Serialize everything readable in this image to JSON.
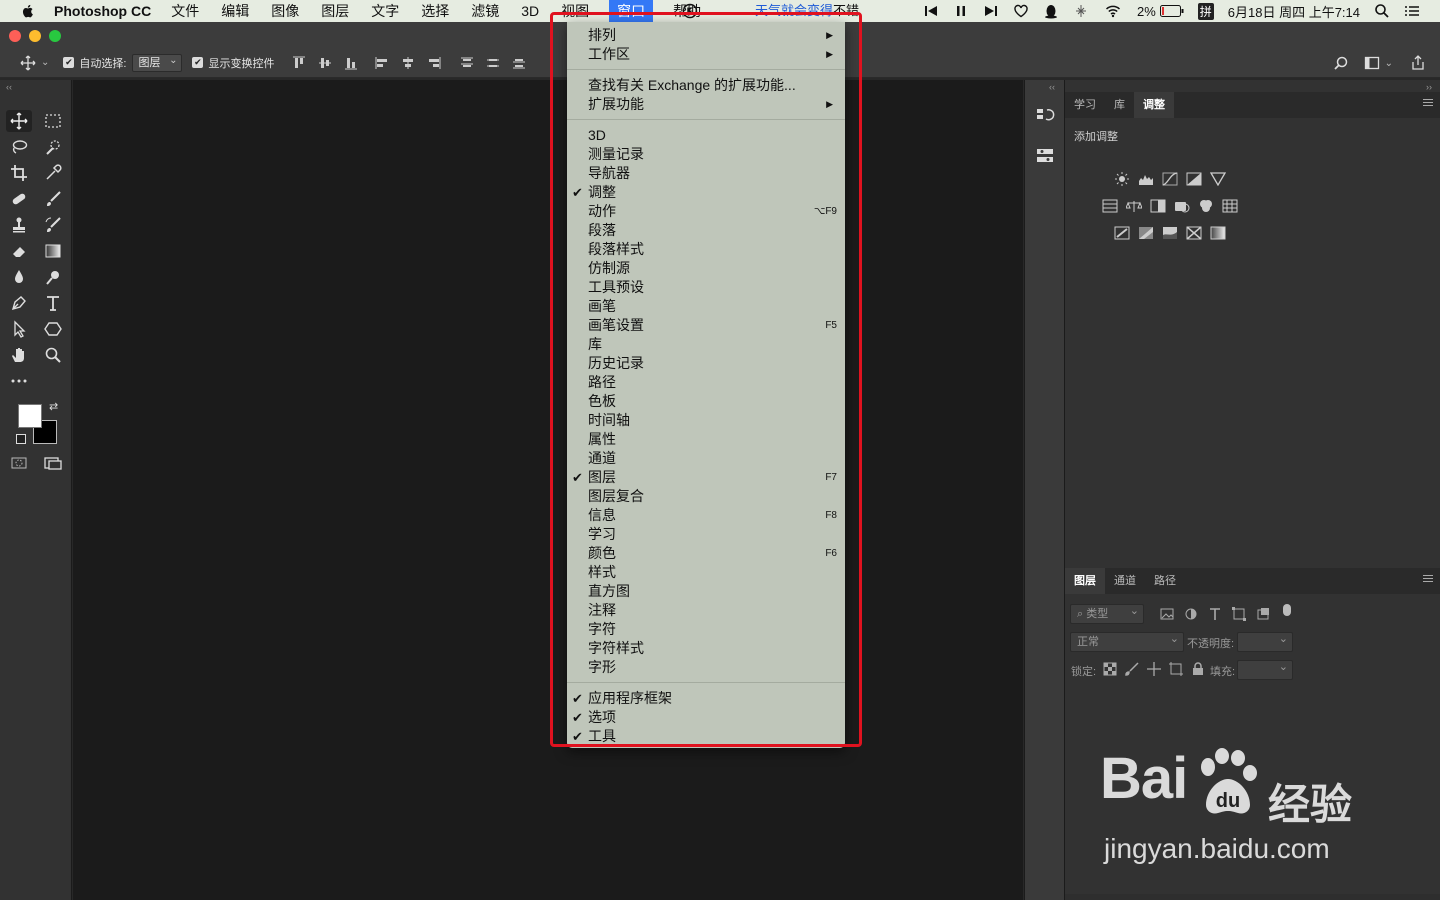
{
  "menubar": {
    "app_name": "Photoshop CC",
    "items": [
      "文件",
      "编辑",
      "图像",
      "图层",
      "文字",
      "选择",
      "滤镜",
      "3D",
      "视图",
      "窗口",
      "帮助"
    ],
    "active_item": "窗口",
    "weather": "天气就会变得",
    "weather_suffix": "不错",
    "battery": "2%",
    "input_method": "拼",
    "datetime": "6月18日 周四 上午7:14"
  },
  "options_bar": {
    "auto_select_label": "自动选择:",
    "auto_select_value": "图层",
    "show_transform_label": "显示变换控件"
  },
  "panels": {
    "top_tabs": [
      "学习",
      "库",
      "调整"
    ],
    "top_active": "调整",
    "add_adjustment_label": "添加调整",
    "bottom_tabs": [
      "图层",
      "通道",
      "路径"
    ],
    "bottom_active": "图层",
    "filter_kind": "类型",
    "blend_mode": "正常",
    "opacity_label": "不透明度:",
    "lock_label": "锁定:",
    "fill_label": "填充:"
  },
  "window_menu": {
    "items": [
      {
        "label": "排列",
        "submenu": true
      },
      {
        "label": "工作区",
        "submenu": true
      },
      {
        "separator": true
      },
      {
        "label": "查找有关 Exchange 的扩展功能..."
      },
      {
        "label": "扩展功能",
        "submenu": true
      },
      {
        "separator": true
      },
      {
        "label": "3D"
      },
      {
        "label": "测量记录"
      },
      {
        "label": "导航器"
      },
      {
        "label": "调整",
        "checked": true
      },
      {
        "label": "动作",
        "shortcut": "⌥F9"
      },
      {
        "label": "段落"
      },
      {
        "label": "段落样式"
      },
      {
        "label": "仿制源"
      },
      {
        "label": "工具预设"
      },
      {
        "label": "画笔"
      },
      {
        "label": "画笔设置",
        "shortcut": "F5"
      },
      {
        "label": "库"
      },
      {
        "label": "历史记录"
      },
      {
        "label": "路径"
      },
      {
        "label": "色板"
      },
      {
        "label": "时间轴"
      },
      {
        "label": "属性"
      },
      {
        "label": "通道"
      },
      {
        "label": "图层",
        "checked": true,
        "shortcut": "F7"
      },
      {
        "label": "图层复合"
      },
      {
        "label": "信息",
        "shortcut": "F8"
      },
      {
        "label": "学习"
      },
      {
        "label": "颜色",
        "shortcut": "F6"
      },
      {
        "label": "样式"
      },
      {
        "label": "直方图"
      },
      {
        "label": "注释"
      },
      {
        "label": "字符"
      },
      {
        "label": "字符样式"
      },
      {
        "label": "字形"
      },
      {
        "separator": true
      },
      {
        "label": "应用程序框架",
        "checked": true
      },
      {
        "label": "选项",
        "checked": true
      },
      {
        "label": "工具",
        "checked": true
      }
    ]
  },
  "watermark": {
    "brand": "Bai",
    "brand_cn": "经验",
    "url": "jingyan.baidu.com"
  },
  "colors": {
    "highlight": "#e0121f",
    "menu_bg": "#bfc6ba",
    "active_menu": "#3478f6"
  }
}
